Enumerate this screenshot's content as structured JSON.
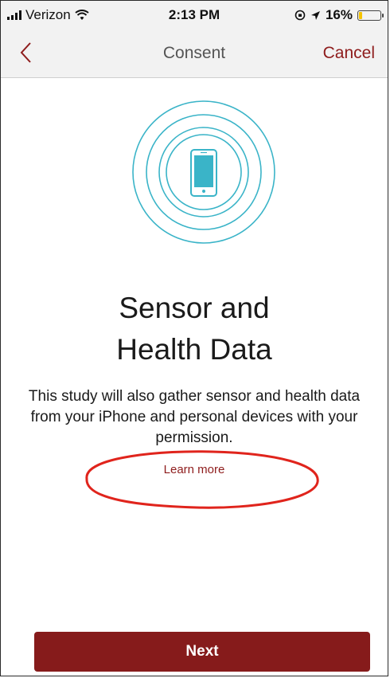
{
  "status_bar": {
    "carrier": "Verizon",
    "time": "2:13 PM",
    "battery": "16%",
    "battery_level": 0.16
  },
  "nav": {
    "title": "Consent",
    "cancel_label": "Cancel",
    "back_icon": "chevron-left-icon"
  },
  "content": {
    "icon": "phone-sensor-rings-icon",
    "headline_line1": "Sensor and",
    "headline_line2": "Health Data",
    "body": "This study will also gather sensor and health data from your iPhone and personal devices with your permission.",
    "learn_more": "Learn more"
  },
  "footer": {
    "next_label": "Next"
  },
  "colors": {
    "accent": "#861b1b",
    "icon_teal": "#3ab4c8",
    "annotation_red": "#e0241c",
    "bar_bg": "#f2f2f2"
  }
}
